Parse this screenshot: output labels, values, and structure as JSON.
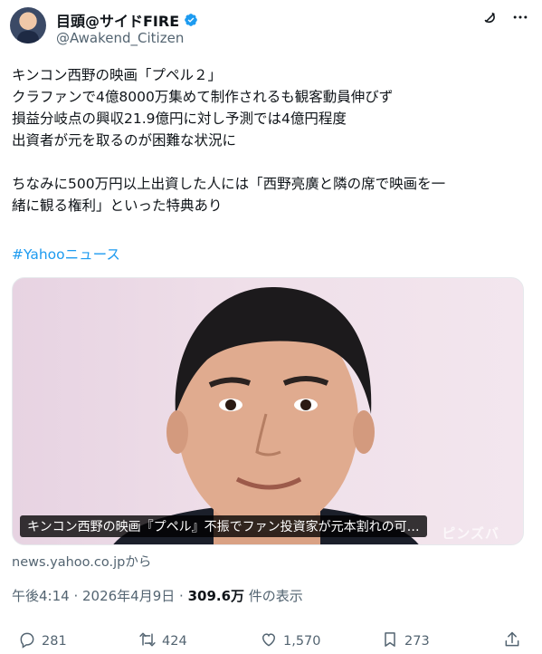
{
  "author": {
    "display_name": "目頭@サイドFIRE",
    "handle": "@Awakend_Citizen",
    "verified_color": "#1d9bf0"
  },
  "icons": {
    "verified": "verified-badge-icon",
    "grok": "grok-icon",
    "more": "more-icon",
    "reply": "reply-icon",
    "repost": "repost-icon",
    "like": "like-icon",
    "bookmark": "bookmark-icon",
    "share": "share-icon"
  },
  "tweet": {
    "lines": [
      "キンコン西野の映画「プペル２」",
      "クラファンで4億8000万集めて制作されるも観客動員伸びず",
      "損益分岐点の興収21.9億円に対し予測では4億円程度",
      "出資者が元を取るのが困難な状況に",
      "ちなみに500万円以上出資した人には「西野亮廣と隣の席で映画を一",
      "緒に観る権利」といった特典あり"
    ],
    "hashtag": "#Yahooニュース"
  },
  "card": {
    "caption": "キンコン西野の映画『プペル』不振でファン投資家が元本割れの可…",
    "watermark": "ピンズバ",
    "source": "news.yahoo.co.jpから"
  },
  "meta": {
    "time": "午後4:14",
    "separator": " · ",
    "date": "2026年4月9日",
    "views_count": "309.6万",
    "views_label": " 件の表示"
  },
  "stats": {
    "replies": "281",
    "reposts": "424",
    "likes": "1,570",
    "bookmarks": "273"
  },
  "colors": {
    "text": "#0f1419",
    "secondary": "#536471",
    "link": "#1d9bf0"
  }
}
